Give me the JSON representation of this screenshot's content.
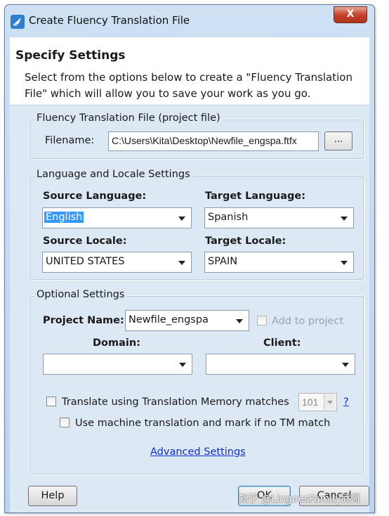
{
  "window": {
    "title": "Create Fluency Translation File",
    "close_label": "X"
  },
  "header": {
    "title": "Specify Settings",
    "description": "Select from the options below to create a \"Fluency Translation File\" which will allow you to save your work as you go."
  },
  "project_file": {
    "legend": "Fluency Translation File (project file)",
    "filename_label": "Filename:",
    "filename_value": "C:\\Users\\Kita\\Desktop\\Newfile_engspa.ftfx",
    "browse_label": "..."
  },
  "language": {
    "legend": "Language and Locale Settings",
    "source_language_label": "Source Language:",
    "source_language_value": "English",
    "target_language_label": "Target Language:",
    "target_language_value": "Spanish",
    "source_locale_label": "Source Locale:",
    "source_locale_value": "UNITED STATES",
    "target_locale_label": "Target Locale:",
    "target_locale_value": "SPAIN"
  },
  "optional": {
    "legend": "Optional Settings",
    "project_name_label": "Project Name:",
    "project_name_value": "Newfile_engspa",
    "add_to_project_label": "Add to project",
    "domain_label": "Domain:",
    "domain_value": "",
    "client_label": "Client:",
    "client_value": "",
    "tm_label": "Translate using Translation Memory matches",
    "tm_threshold": "101",
    "help_link": "?",
    "mt_label": "Use machine translation and mark if no TM match",
    "advanced_link": "Advanced Settings"
  },
  "buttons": {
    "help": "Help",
    "ok": "OK",
    "cancel": "Cancel"
  },
  "watermark": "知乎 @LingoesFamily武哥",
  "colors": {
    "accent": "#3399ff",
    "link": "#0b2fd0",
    "close": "#c7432a"
  }
}
